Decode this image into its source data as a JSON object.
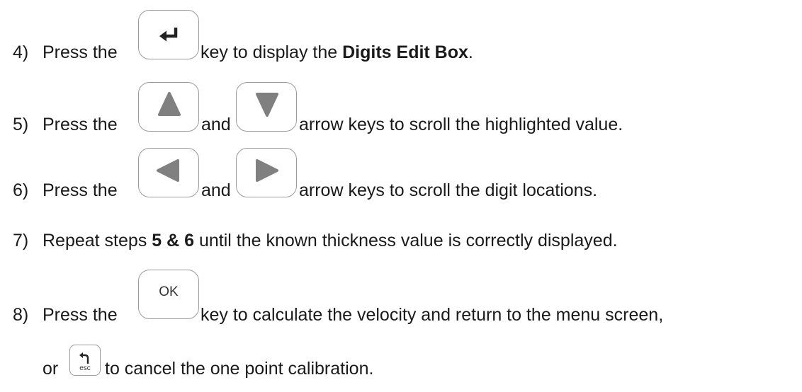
{
  "steps": [
    {
      "number": "4)",
      "before": "Press the",
      "key": "enter-icon",
      "after_text": "key to display the ",
      "after_bold": "Digits Edit Box",
      "after_end": "."
    },
    {
      "number": "5)",
      "before": "Press the",
      "key1": "up-arrow-icon",
      "and": "and",
      "key2": "down-arrow-icon",
      "after": "arrow keys to scroll the highlighted value."
    },
    {
      "number": "6)",
      "before": "Press the",
      "key1": "left-arrow-icon",
      "and": "and",
      "key2": "right-arrow-icon",
      "after": "arrow keys to scroll the digit locations."
    },
    {
      "number": "7)",
      "text1": "Repeat steps ",
      "bold": "5 & 6",
      "text2": " until the known thickness value is correctly displayed."
    },
    {
      "number": "8)",
      "before": "Press the",
      "key_label": "OK",
      "after": "key to calculate the velocity and return to the menu screen,",
      "or": "or",
      "esc_label": "esc",
      "after2": "to cancel the one point calibration."
    }
  ],
  "colors": {
    "text": "#1a1a1a",
    "key_border": "#9a9a9a",
    "arrow_fill": "#808080",
    "icon_dark": "#222222"
  }
}
